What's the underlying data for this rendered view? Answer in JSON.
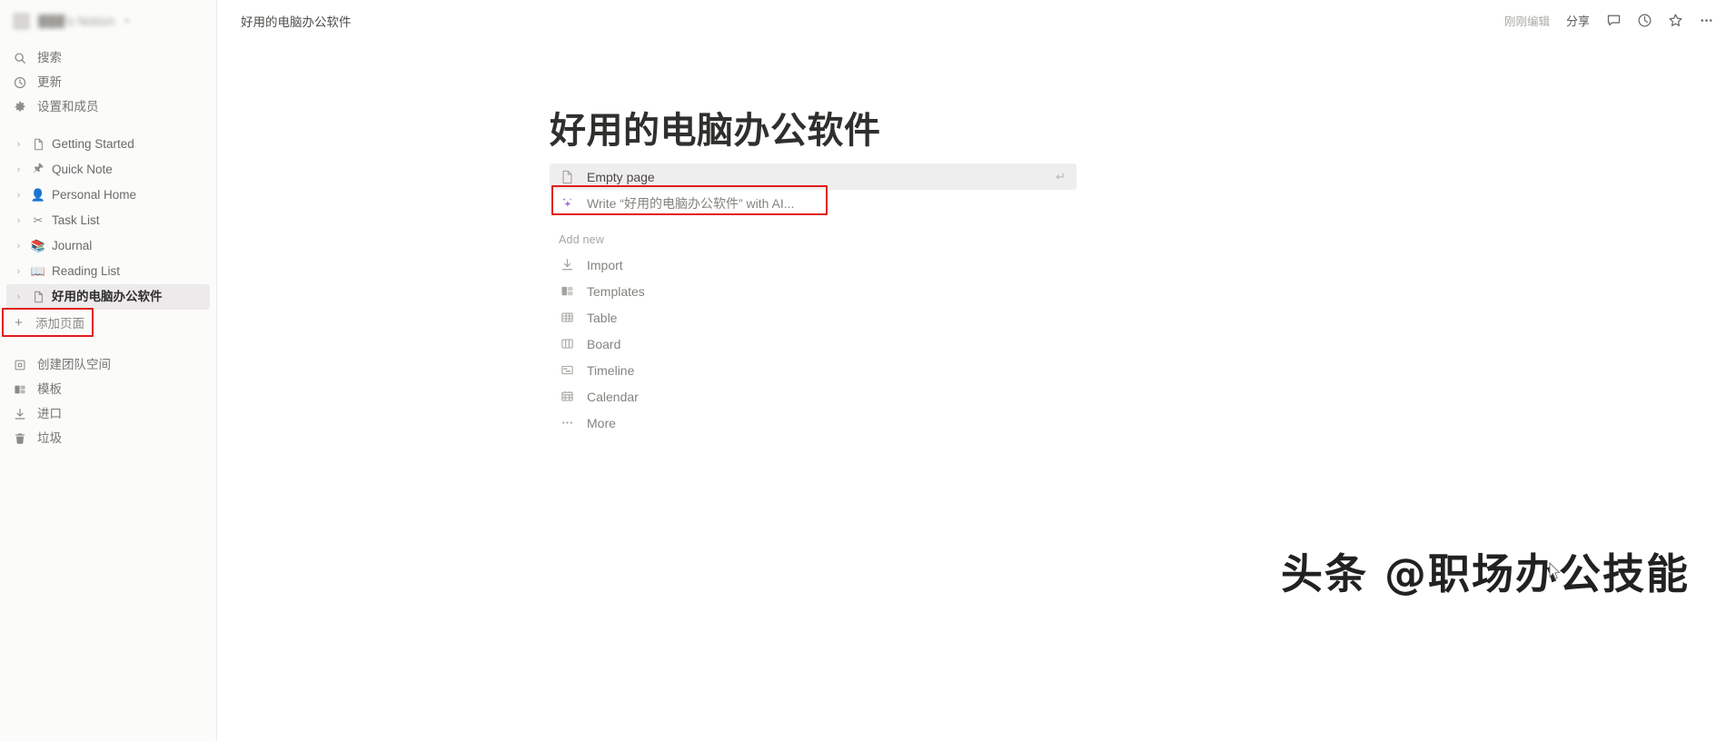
{
  "sidebar": {
    "workspace": {
      "name": "███'s Notion",
      "avatar_icon": "workspace-avatar",
      "caret_icon": "chevron-updown-icon"
    },
    "nav": [
      {
        "label": "搜索",
        "icon": "search-icon"
      },
      {
        "label": "更新",
        "icon": "clock-updates-icon"
      },
      {
        "label": "设置和成员",
        "icon": "gear-icon"
      }
    ],
    "pages": [
      {
        "label": "Getting Started",
        "icon": "document-icon",
        "selected": false
      },
      {
        "label": "Quick Note",
        "icon": "pin-icon",
        "selected": false
      },
      {
        "label": "Personal Home",
        "icon": "person-icon",
        "selected": false
      },
      {
        "label": "Task List",
        "icon": "scissors-icon",
        "selected": false
      },
      {
        "label": "Journal",
        "icon": "books-icon",
        "selected": false
      },
      {
        "label": "Reading List",
        "icon": "bookshelf-icon",
        "selected": false
      },
      {
        "label": "好用的电脑办公软件",
        "icon": "document-icon",
        "selected": true
      }
    ],
    "add_page": {
      "label": "添加页面",
      "icon": "plus-icon",
      "highlighted": true
    },
    "footer": [
      {
        "label": "创建团队空间",
        "icon": "teamspace-icon"
      },
      {
        "label": "模板",
        "icon": "templates-icon"
      },
      {
        "label": "进口",
        "icon": "import-icon"
      },
      {
        "label": "垃圾",
        "icon": "trash-icon"
      }
    ]
  },
  "topbar": {
    "breadcrumb": "好用的电脑办公软件",
    "edited_status": "刚刚编辑",
    "share_label": "分享",
    "icons": {
      "comment": "comment-icon",
      "history": "clock-history-icon",
      "favorite": "star-icon",
      "more": "ellipsis-icon"
    }
  },
  "page": {
    "title": "好用的电脑办公软件",
    "suggestions": [
      {
        "label": "Empty page",
        "icon": "document-icon",
        "enter_hint": "↵",
        "hovered": true,
        "highlighted": false
      },
      {
        "label": "Write “好用的电脑办公软件” with AI...",
        "icon": "ai-sparkle-icon",
        "enter_hint": "",
        "hovered": false,
        "highlighted": true
      }
    ],
    "add_new_label": "Add new",
    "add_new_items": [
      {
        "label": "Import",
        "icon": "import-icon"
      },
      {
        "label": "Templates",
        "icon": "templates-icon"
      },
      {
        "label": "Table",
        "icon": "table-icon"
      },
      {
        "label": "Board",
        "icon": "board-icon"
      },
      {
        "label": "Timeline",
        "icon": "timeline-icon"
      },
      {
        "label": "Calendar",
        "icon": "calendar-icon"
      },
      {
        "label": "More",
        "icon": "ellipsis-icon"
      }
    ]
  },
  "watermark": {
    "text": "头条 @职场办公技能"
  },
  "colors": {
    "sidebar_bg": "#fbfbfa",
    "page_bg": "#ffffff",
    "highlight_red": "#e21b1b",
    "selected_row": "#eceaea",
    "hover_row": "#efeeee",
    "ai_purple": "#9a6ad6",
    "text_primary": "#2f2f2d",
    "text_muted": "#84837f"
  }
}
